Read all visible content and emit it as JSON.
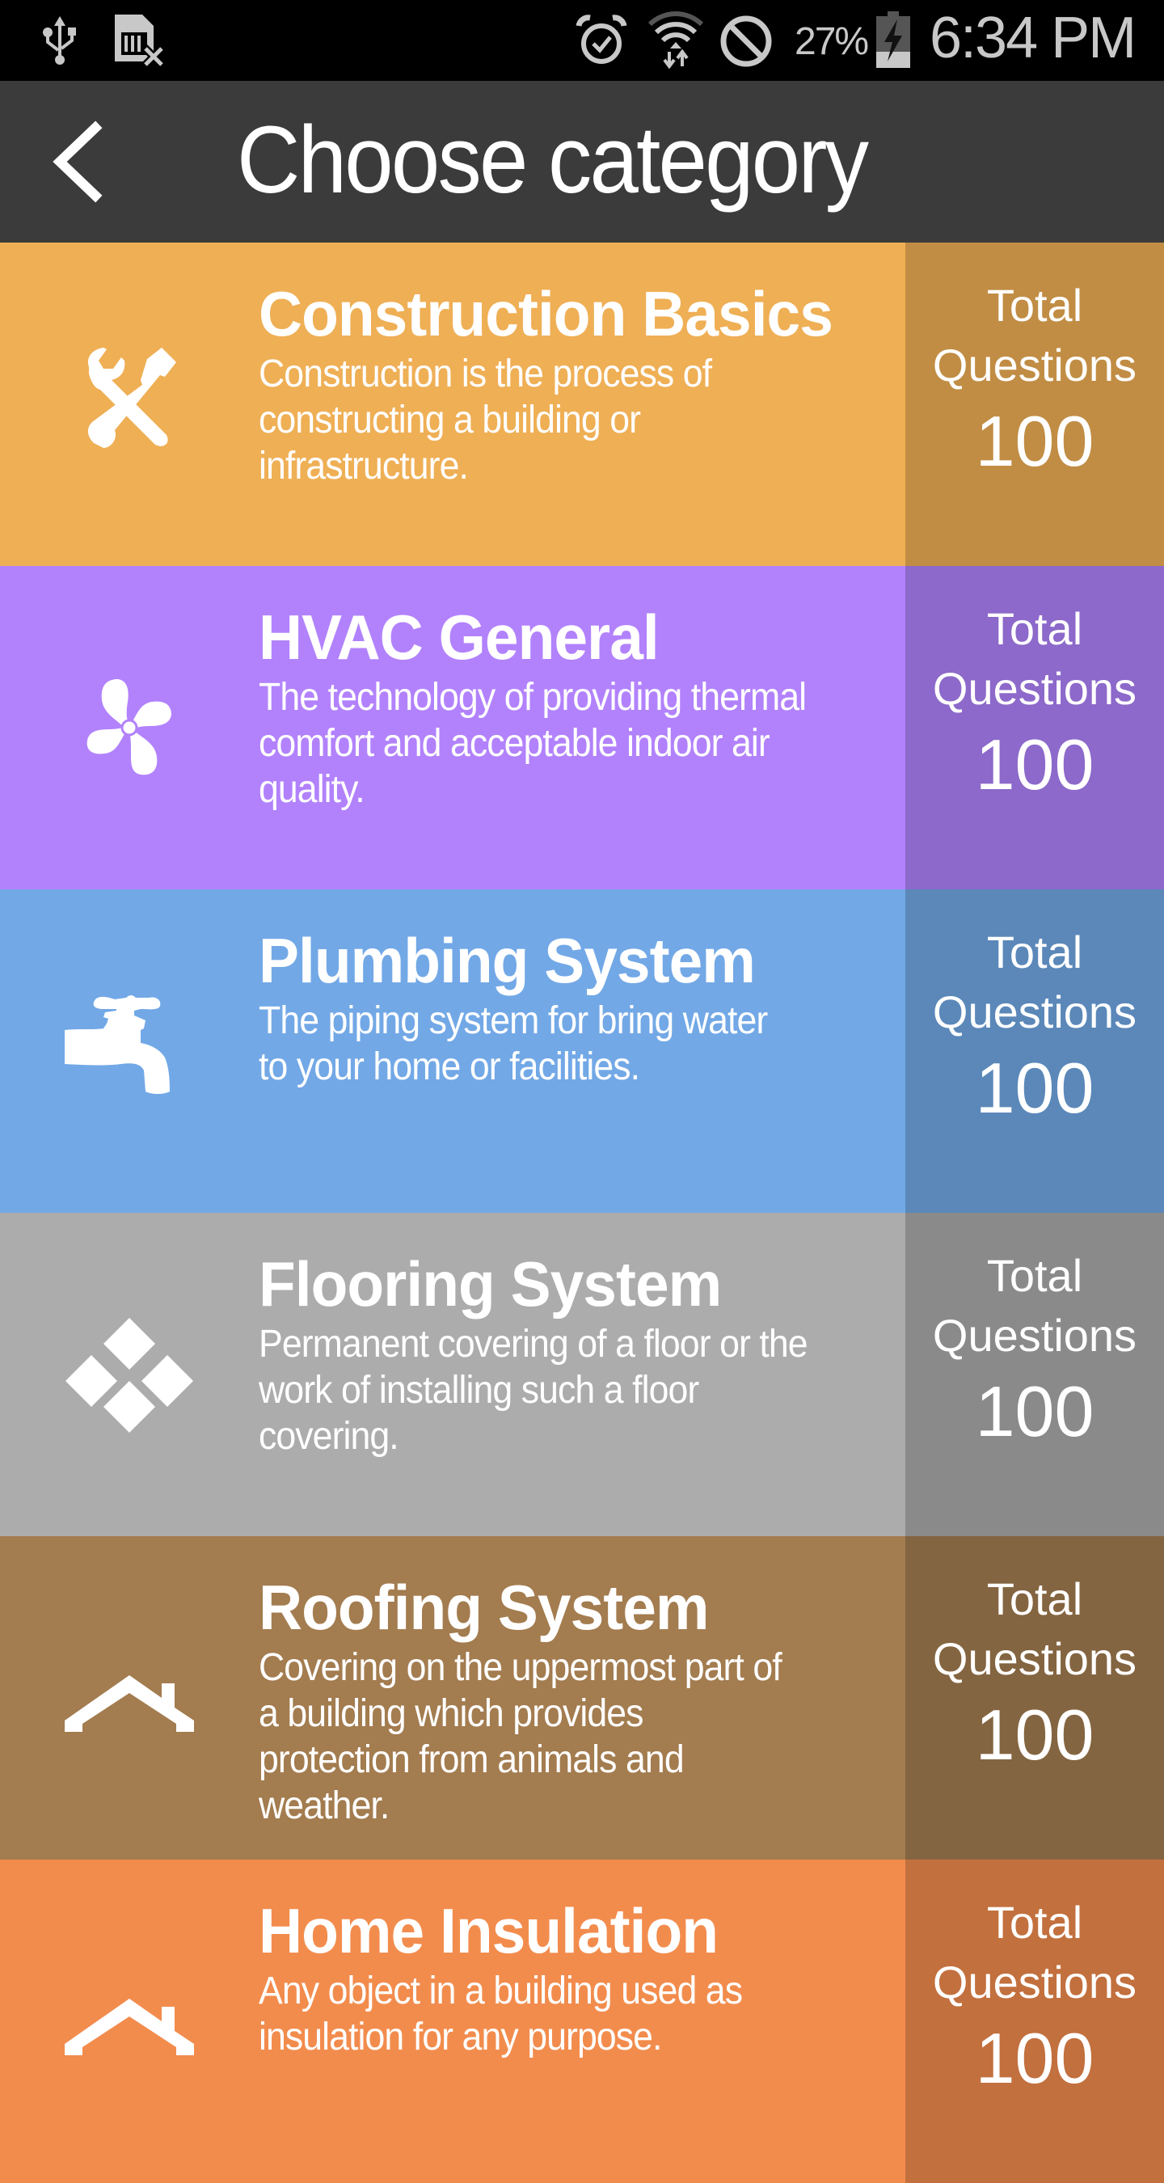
{
  "status_bar": {
    "left_icons": [
      "usb-icon",
      "no-sim-icon"
    ],
    "right_icons": [
      "alarm-icon",
      "wifi-data-icon",
      "do-not-disturb-icon",
      "battery-charging-icon"
    ],
    "battery_percent": "27%",
    "time": "6:34 PM"
  },
  "header": {
    "back_icon": "chevron-left-icon",
    "title": "Choose category"
  },
  "categories": [
    {
      "name": "Construction Basics",
      "icon": "tools-icon",
      "desc_lines": [
        "Construction is the process of",
        "constructing a building or",
        "infrastructure."
      ],
      "total_label_1": "Total",
      "total_label_2": "Questions",
      "count": "100",
      "color": "#efaf55",
      "panel_color": "#c18d44"
    },
    {
      "name": "HVAC General",
      "icon": "fan-icon",
      "desc_lines": [
        "The technology of providing thermal",
        "comfort and acceptable indoor air",
        "quality."
      ],
      "total_label_1": "Total",
      "total_label_2": "Questions",
      "count": "100",
      "color": "#b282fc",
      "panel_color": "#8c69ca"
    },
    {
      "name": "Plumbing System",
      "icon": "faucet-icon",
      "desc_lines": [
        "The piping system for bring water",
        "to your home or facilities."
      ],
      "total_label_1": "Total",
      "total_label_2": "Questions",
      "count": "100",
      "color": "#72a8e6",
      "panel_color": "#5b88b9"
    },
    {
      "name": "Flooring System",
      "icon": "floor-tiles-icon",
      "desc_lines": [
        "Permanent covering of a floor or the",
        "work of installing such a floor",
        "covering."
      ],
      "total_label_1": "Total",
      "total_label_2": "Questions",
      "count": "100",
      "color": "#acacac",
      "panel_color": "#8a8a8a"
    },
    {
      "name": "Roofing System",
      "icon": "roof-icon",
      "desc_lines": [
        "Covering on the uppermost part of",
        "a building which provides",
        "protection from animals and",
        "weather."
      ],
      "total_label_1": "Total",
      "total_label_2": "Questions",
      "count": "100",
      "color": "#a37c4f",
      "panel_color": "#846541"
    },
    {
      "name": "Home Insulation",
      "icon": "roof-icon",
      "desc_lines": [
        "Any object in a building used as",
        "insulation for any purpose."
      ],
      "total_label_1": "Total",
      "total_label_2": "Questions",
      "count": "100",
      "color": "#f28c4d",
      "panel_color": "#c2703e"
    }
  ]
}
